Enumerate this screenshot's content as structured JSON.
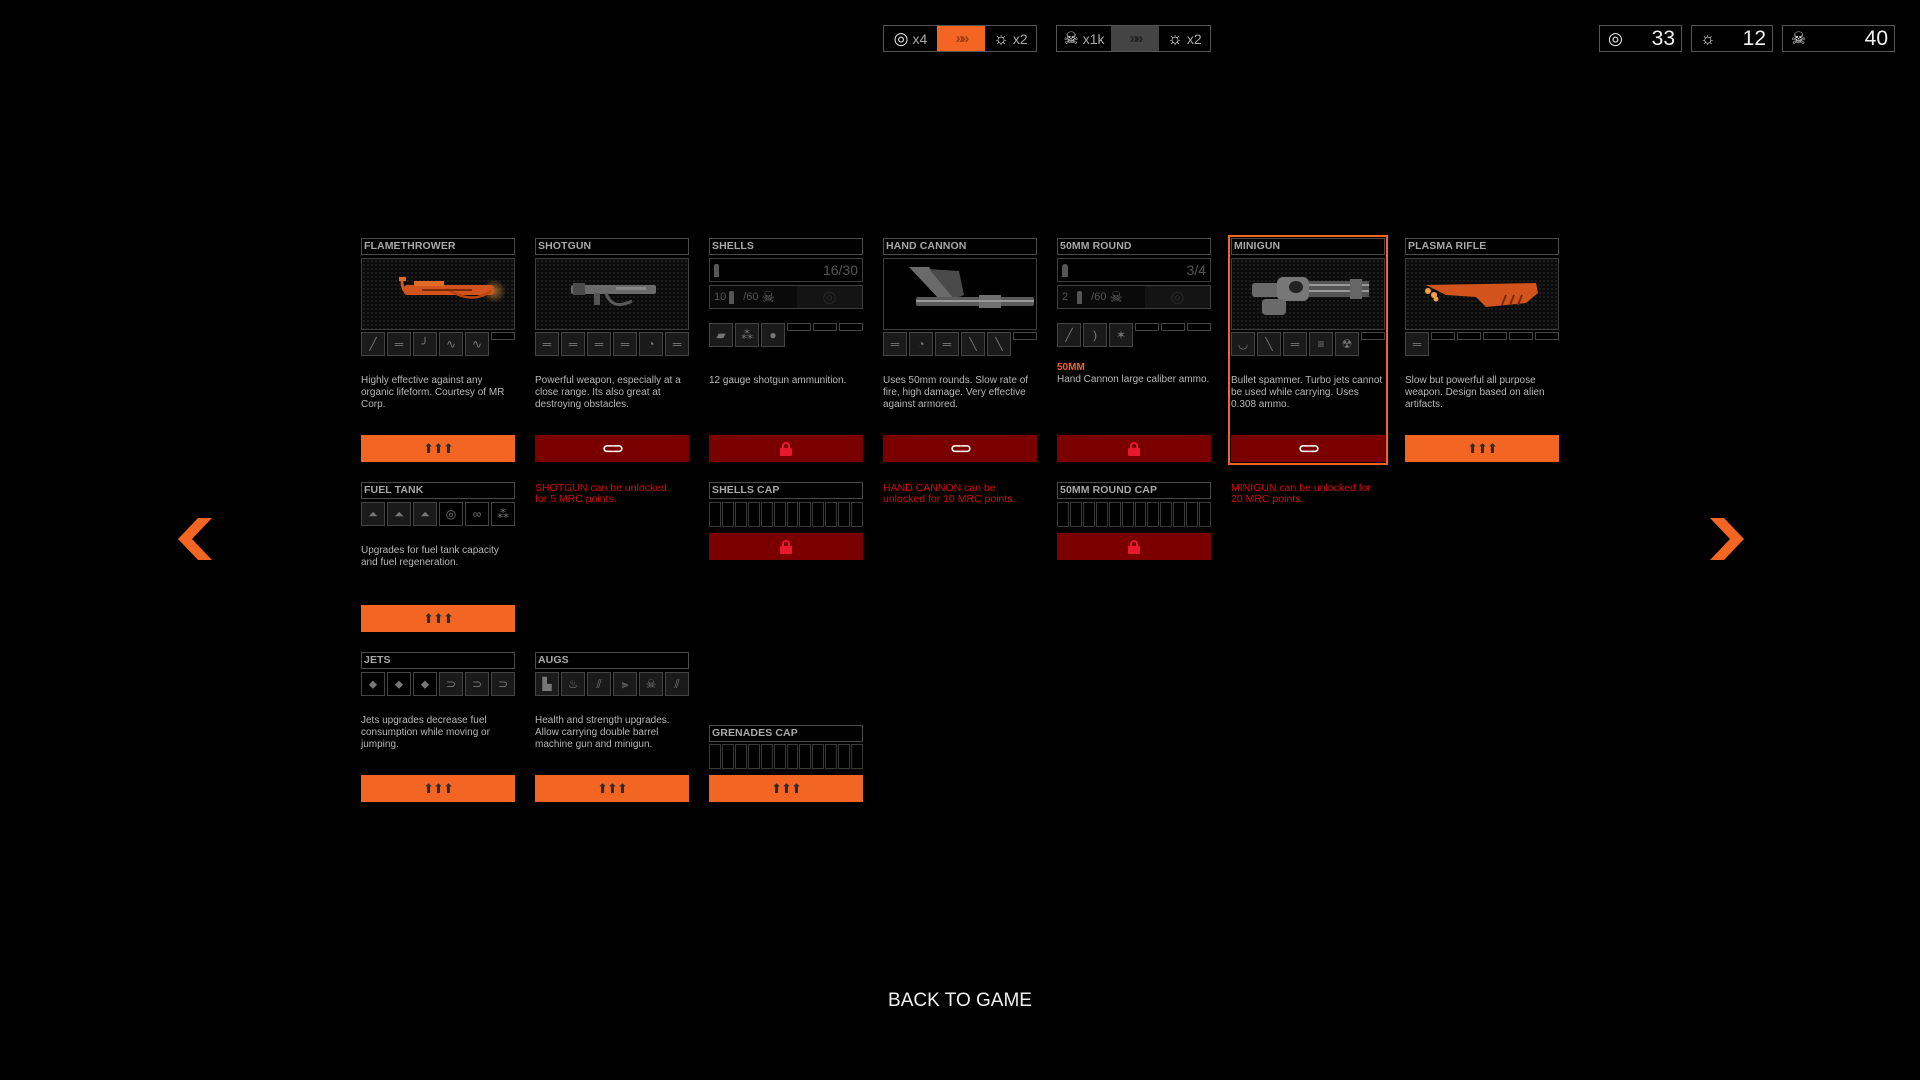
{
  "exchange": [
    {
      "from_icon": "signal-icon",
      "from_label": "x4",
      "to_icon": "bug-icon",
      "to_label": "x2",
      "state": "active"
    },
    {
      "from_icon": "skull-icon",
      "from_label": "x1k",
      "to_icon": "bug-icon",
      "to_label": "x2",
      "state": "inactive"
    }
  ],
  "stats": [
    {
      "icon": "signal-icon",
      "value": "33"
    },
    {
      "icon": "bug-icon",
      "value": "12"
    },
    {
      "icon": "skull-icon",
      "value": "40"
    }
  ],
  "weapons": [
    {
      "title": "FLAMETHROWER",
      "desc": "Highly effective against any organic lifeform. Courtesy of MR Corp.",
      "action": "upgrade",
      "thumbs": 5,
      "empty": 1
    },
    {
      "title": "SHOTGUN",
      "desc": "Powerful weapon, especially at a close range. Its also great at destroying obstacles.",
      "action": "unlock",
      "thumbs": 6,
      "empty": 0,
      "message": "SHOTGUN can be unlocked for 5 MRC points."
    },
    {
      "title": "SHELLS",
      "desc": "12 gauge shotgun ammunition.",
      "action": "locked",
      "ammo": "16/30",
      "reserve_count": "10",
      "reserve_max": "/60",
      "thumbs": 3,
      "empty": 3
    },
    {
      "title": "HAND CANNON",
      "desc": "Uses 50mm rounds. Slow rate of fire, high damage. Very effective against armored.",
      "action": "unlock",
      "thumbs": 5,
      "empty": 1,
      "message": "HAND CANNON can be unlocked for 10 MRC points."
    },
    {
      "title": "50MM ROUND",
      "hint": "50MM",
      "desc": "Hand Cannon large caliber ammo.",
      "action": "locked",
      "ammo": "3/4",
      "reserve_count": "2",
      "reserve_max": "/60",
      "thumbs": 3,
      "empty": 3
    },
    {
      "title": "MINIGUN",
      "desc": "Bullet spammer. Turbo jets cannot be used while carrying. Uses 0.308 ammo.",
      "action": "unlock",
      "thumbs": 5,
      "empty": 1,
      "selected": true,
      "message": "MINIGUN can be unlocked for 20 MRC points."
    },
    {
      "title": "PLASMA RIFLE",
      "desc": "Slow but powerful all purpose weapon. Design based on alien artifacts.",
      "action": "upgrade",
      "thumbs": 1,
      "empty": 5
    }
  ],
  "upgrades": {
    "fuel_tank": {
      "title": "FUEL TANK",
      "desc": "Upgrades for fuel tank capacity and fuel regeneration.",
      "action": "upgrade"
    },
    "jets": {
      "title": "JETS",
      "desc": "Jets upgrades decrease fuel consumption while moving or jumping.",
      "action": "upgrade"
    },
    "augs": {
      "title": "AUGS",
      "desc": "Health and strength upgrades. Allow carrying double barrel machine gun and minigun.",
      "action": "upgrade"
    },
    "shells_cap": {
      "title": "SHELLS CAP",
      "slots": 12,
      "filled": 0,
      "action": "locked"
    },
    "round_cap": {
      "title": "50MM ROUND CAP",
      "slots": 12,
      "filled": 0,
      "action": "locked"
    },
    "grenades_cap": {
      "title": "GRENADES CAP",
      "slots": 12,
      "filled": 0,
      "action": "upgrade"
    }
  },
  "navigation": {
    "prev": "previous-page",
    "next": "next-page"
  },
  "back_label": "BACK TO GAME",
  "colors": {
    "accent": "#f26522",
    "locked": "#7a0000",
    "lock_icon": "#e8192c",
    "message": "#d40a0a"
  }
}
